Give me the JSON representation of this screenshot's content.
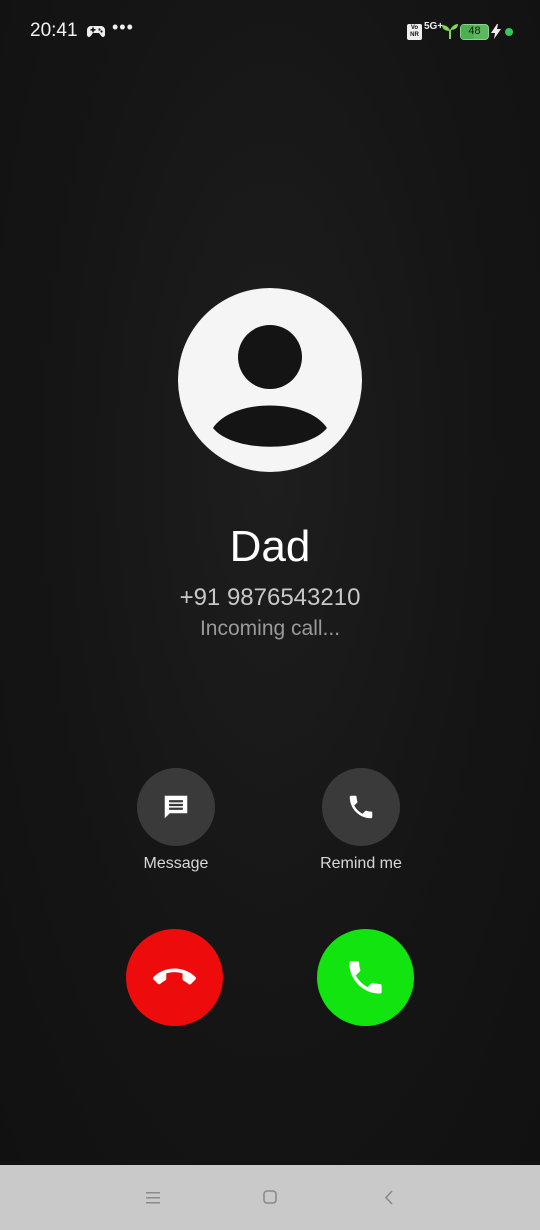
{
  "status_bar": {
    "time": "20:41",
    "more": "•••",
    "volte_label": "Vo NR",
    "network": "5G+",
    "battery_level": 48,
    "battery_text": "48",
    "icons": [
      "gamepad-icon",
      "more-icon",
      "volte-icon",
      "5g-icon",
      "sprout-icon",
      "battery-icon",
      "charging-bolt-icon",
      "green-dot-icon"
    ]
  },
  "caller": {
    "name": "Dad",
    "number": "+91 9876543210",
    "status": "Incoming call..."
  },
  "actions": {
    "message_label": "Message",
    "remind_label": "Remind me"
  },
  "colors": {
    "decline": "#ee0b0b",
    "accept": "#12e410",
    "action_bg": "#3a3a3a",
    "background": "#141414",
    "nav_bar": "#c9c9c9"
  },
  "nav_bar": {
    "icons": [
      "menu-icon",
      "home-icon",
      "back-icon"
    ]
  }
}
